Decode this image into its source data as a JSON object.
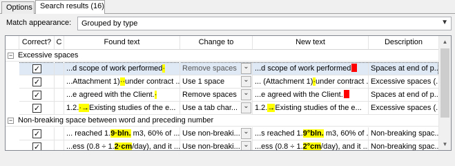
{
  "tabs": [
    {
      "label": "Options"
    },
    {
      "label": "Search results (16)"
    }
  ],
  "match": {
    "label": "Match appearance:",
    "value": "Grouped by type"
  },
  "columns": {
    "correct": "Correct?",
    "c": "C",
    "found": "Found text",
    "change": "Change to",
    "new": "New text",
    "desc": "Description"
  },
  "groups": [
    {
      "title": "Excessive spaces",
      "rows": [
        {
          "checked": true,
          "found_pre": "...d scope of work performed",
          "found_mark": "·",
          "found_post": "",
          "change": "Remove spaces",
          "new_pre": "...d scope of work performed",
          "new_mark": "",
          "new_post": "",
          "desc": "Spaces at end of p..."
        },
        {
          "checked": true,
          "found_pre": "...Attachment 1)",
          "found_mark": "··",
          "found_post": "under contract ...",
          "change": "Use 1 space",
          "new_pre": "... (Attachment 1)",
          "new_mark": "·",
          "new_post": "under contract ...",
          "desc": "Excessive spaces (..."
        },
        {
          "checked": true,
          "found_pre": "...e agreed with the Client.",
          "found_mark": "·",
          "found_post": "",
          "change": "Remove spaces",
          "new_pre": "...e agreed with the Client.",
          "new_mark": "",
          "new_post": "",
          "desc": "Spaces at end of p..."
        },
        {
          "checked": true,
          "found_pre": "1.2.",
          "found_mark": "·→",
          "found_post": "Existing studies of the e...",
          "change": "Use a tab char...",
          "new_pre": "1.2.",
          "new_mark": "→",
          "new_post": "Existing studies of the e...",
          "desc": "Excessive spaces (..."
        }
      ]
    },
    {
      "title": "Non-breaking space between word and preceding number",
      "rows": [
        {
          "checked": true,
          "found_pre": "... reached 1.",
          "found_mark": "9·bln.",
          "found_post": " m3, 60% of ...",
          "change": "Use non-breaki...",
          "new_pre": "...s reached 1.",
          "new_mark": "9°bln.",
          "new_post": " m3, 60% of ...",
          "desc": "Non-breaking spac..."
        },
        {
          "checked": true,
          "found_pre": "...ess (0.8 ÷ 1.",
          "found_mark": "2·cm",
          "found_post": "/day), and it ...",
          "change": "Use non-breaki...",
          "new_pre": "...ess (0.8 ÷ 1.",
          "new_mark": "2°cm",
          "new_post": "/day), and it ...",
          "desc": "Non-breaking spac..."
        }
      ]
    }
  ],
  "icons": {
    "check": "check-icon",
    "dropdown": "chevron-down-icon",
    "collapse": "minus-box-icon"
  },
  "colors": {
    "highlight": "#ffff00",
    "selection": "#dfe9f5",
    "marker": "#ff0000"
  }
}
